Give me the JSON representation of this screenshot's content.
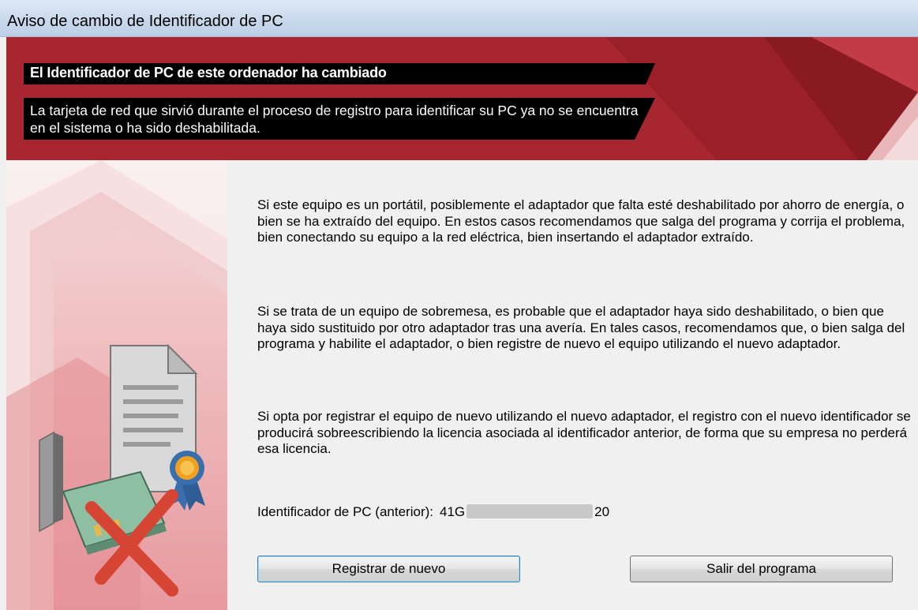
{
  "window": {
    "title": "Aviso de cambio de Identificador de PC"
  },
  "header": {
    "title": "El Identificador de PC de este ordenador ha cambiado",
    "description": "La tarjeta de red que sirvió durante el proceso de registro para identificar su PC ya no se encuentra en el sistema o ha sido deshabilitada."
  },
  "body": {
    "paragraph_laptop": "Si este equipo es un portátil, posiblemente el adaptador que falta esté deshabilitado por ahorro de energía, o bien se ha extraído del equipo. En estos casos recomendamos que salga del programa y corrija el problema, bien conectando su equipo a la red eléctrica, bien insertando el adaptador extraído.",
    "paragraph_desktop": "Si se trata de un equipo de sobremesa, es probable que el adaptador haya sido deshabilitado, o bien que haya sido sustituido por otro adaptador tras una avería. En tales casos, recomendamos que, o bien salga del programa y habilite el adaptador, o bien registre de nuevo el equipo utilizando el nuevo adaptador.",
    "paragraph_reregister": "Si opta por registrar el equipo de nuevo utilizando el nuevo adaptador, el registro con el nuevo identificador se producirá sobreescribiendo la licencia asociada al identificador anterior, de forma que su empresa no perderá esa licencia.",
    "pc_id_label": "Identificador de PC (anterior):",
    "pc_id_value_start": "41G",
    "pc_id_value_end": "20"
  },
  "buttons": {
    "register_again": "Registrar de nuevo",
    "exit_program": "Salir del programa"
  },
  "icons": {
    "illustration": [
      "document-icon",
      "award-ribbon-icon",
      "network-card-icon",
      "red-x-icon"
    ]
  },
  "colors": {
    "header_red": "#a8262f",
    "header_dark_red": "#7d1a22",
    "text_box_black": "#000000",
    "focus_blue": "#3c7fb1",
    "x_red": "#d64434"
  }
}
